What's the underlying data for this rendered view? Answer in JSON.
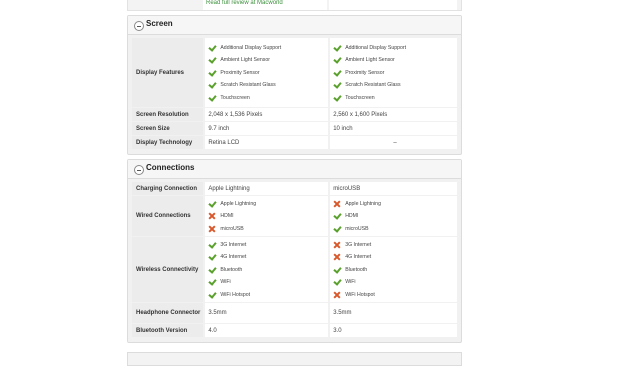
{
  "top": {
    "review_link": "Read full review at Macworld"
  },
  "screen": {
    "title": "Screen",
    "display_features_label": "Display Features",
    "features_left": [
      {
        "text": "Additional Display Support",
        "ok": true
      },
      {
        "text": "Ambient Light Sensor",
        "ok": true
      },
      {
        "text": "Proximity Sensor",
        "ok": true
      },
      {
        "text": "Scratch Resistant Glass",
        "ok": true
      },
      {
        "text": "Touchscreen",
        "ok": true
      }
    ],
    "features_right": [
      {
        "text": "Additional Display Support",
        "ok": true
      },
      {
        "text": "Ambient Light Sensor",
        "ok": true
      },
      {
        "text": "Proximity Sensor",
        "ok": true
      },
      {
        "text": "Scratch Resistant Glass",
        "ok": true
      },
      {
        "text": "Touchscreen",
        "ok": true
      }
    ],
    "resolution_label": "Screen Resolution",
    "resolution_left": "2,048 x 1,536 Pixels",
    "resolution_right": "2,560 x 1,600 Pixels",
    "size_label": "Screen Size",
    "size_left": "9.7 inch",
    "size_right": "10 inch",
    "tech_label": "Display Technology",
    "tech_left": "Retina LCD",
    "tech_right": "–"
  },
  "connections": {
    "title": "Connections",
    "charging_label": "Charging Connection",
    "charging_left": "Apple Lightning",
    "charging_right": "microUSB",
    "wired_label": "Wired Connections",
    "wired_left": [
      {
        "text": "Apple Lightning",
        "ok": true
      },
      {
        "text": "HDMI",
        "ok": false
      },
      {
        "text": "microUSB",
        "ok": false
      }
    ],
    "wired_right": [
      {
        "text": "Apple Lightning",
        "ok": false
      },
      {
        "text": "HDMI",
        "ok": true
      },
      {
        "text": "microUSB",
        "ok": true
      }
    ],
    "wireless_label": "Wireless Connectivity",
    "wireless_left": [
      {
        "text": "3G Internet",
        "ok": true
      },
      {
        "text": "4G Internet",
        "ok": true
      },
      {
        "text": "Bluetooth",
        "ok": true
      },
      {
        "text": "WiFi",
        "ok": true
      },
      {
        "text": "WiFi Hotspot",
        "ok": true
      }
    ],
    "wireless_right": [
      {
        "text": "3G Internet",
        "ok": false
      },
      {
        "text": "4G Internet",
        "ok": false
      },
      {
        "text": "Bluetooth",
        "ok": true
      },
      {
        "text": "WiFi",
        "ok": true
      },
      {
        "text": "WiFi Hotspot",
        "ok": false
      }
    ],
    "headphone_label": "Headphone Connector",
    "headphone_left": "3.5mm",
    "headphone_right": "3.5mm",
    "bt_label": "Bluetooth Version",
    "bt_left": "4.0",
    "bt_right": "3.0"
  },
  "colors": {
    "check": "#5aa02c",
    "cross": "#d8582c",
    "link": "#3c8f3c"
  }
}
